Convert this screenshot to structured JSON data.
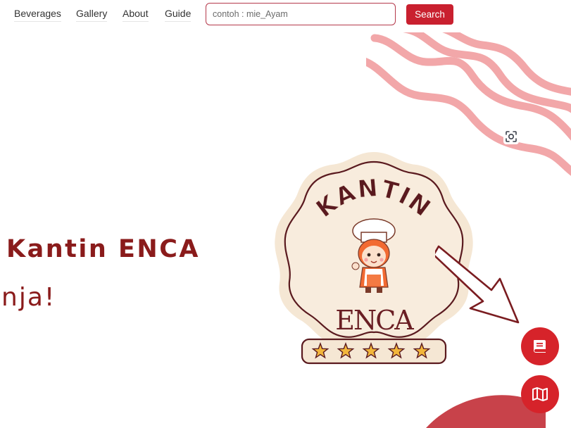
{
  "nav": {
    "items": [
      {
        "label": "Beverages"
      },
      {
        "label": "Gallery"
      },
      {
        "label": "About"
      },
      {
        "label": "Guide"
      }
    ]
  },
  "search": {
    "placeholder": "contoh : mie_Ayam",
    "value": "",
    "button_label": "Search"
  },
  "hero": {
    "title": "Kantin ENCA",
    "subtitle": "ınja!"
  },
  "logo": {
    "top_text": "KANTIN",
    "bottom_text": "ENCA",
    "stars": 5
  },
  "floating_buttons": [
    {
      "icon": "book-icon"
    },
    {
      "icon": "map-icon"
    }
  ],
  "colors": {
    "accent": "#c9202f",
    "brand_dark": "#8a1b1b",
    "logo_bg": "#f5e7d4",
    "wave": "#f2a7a9",
    "star": "#f2b63c"
  }
}
